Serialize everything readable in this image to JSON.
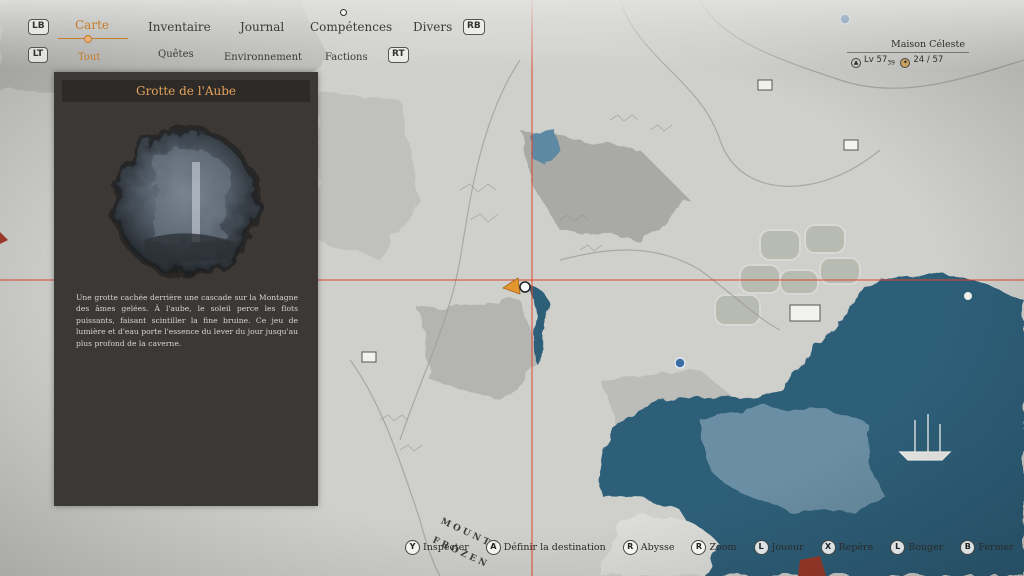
{
  "nav": {
    "left_bumper": "LB",
    "right_bumper": "RB",
    "left_trigger": "LT",
    "right_trigger": "RT",
    "tabs": [
      {
        "label": "Carte",
        "active": true
      },
      {
        "label": "Inventaire",
        "active": false
      },
      {
        "label": "Journal",
        "active": false
      },
      {
        "label": "Compétences",
        "active": false
      },
      {
        "label": "Divers",
        "active": false
      }
    ],
    "subtabs": [
      {
        "label": "Tout",
        "active": true
      },
      {
        "label": "Quêtes",
        "active": false
      },
      {
        "label": "Environnement",
        "active": false
      },
      {
        "label": "Factions",
        "active": false
      }
    ]
  },
  "location_panel": {
    "title": "Grotte de l'Aube",
    "description": "Une grotte cachée derrière une cascade sur la Montagne des âmes gelées. À l'aube, le soleil perce les flots puissants, faisant scintiller la fine bruine. Ce jeu de lumière et d'eau porte l'essence du lever du jour jusqu'au plus profond de la caverne."
  },
  "player_info": {
    "location": "Maison Céleste",
    "level_label": "Lv",
    "level": "57",
    "level_sub": "39",
    "collect_current": "24",
    "collect_separator": "/",
    "collect_total": "57"
  },
  "map": {
    "labels": [
      "MOUNTA",
      "FROZEN"
    ],
    "colors": {
      "land": "#cfcfcc",
      "land_dark": "#a9a9a6",
      "water": "#2e5f79",
      "water_light": "#6a8ea3",
      "crosshair": "#e0452a",
      "marker_orange": "#e3962e"
    }
  },
  "controls": [
    {
      "key": "Y",
      "label": "Inspecter"
    },
    {
      "key": "A",
      "label": "Définir la destination"
    },
    {
      "key": "R",
      "label": "Abysse"
    },
    {
      "key": "R",
      "label": "Zoom"
    },
    {
      "key": "L",
      "label": "Joueur"
    },
    {
      "key": "X",
      "label": "Repère"
    },
    {
      "key": "L",
      "label": "Bouger"
    },
    {
      "key": "B",
      "label": "Fermer"
    }
  ]
}
